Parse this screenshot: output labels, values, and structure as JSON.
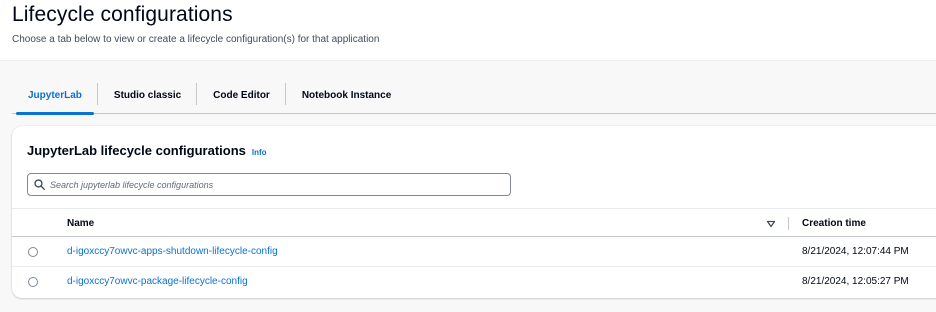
{
  "page": {
    "title": "Lifecycle configurations",
    "subtitle": "Choose a tab below to view or create a lifecycle configuration(s) for that application"
  },
  "tabs": [
    {
      "label": "JupyterLab",
      "active": true
    },
    {
      "label": "Studio classic",
      "active": false
    },
    {
      "label": "Code Editor",
      "active": false
    },
    {
      "label": "Notebook Instance",
      "active": false
    }
  ],
  "panel": {
    "title": "JupyterLab lifecycle configurations",
    "info_label": "Info",
    "search_placeholder": "Search jupyterlab lifecycle configurations"
  },
  "table": {
    "columns": {
      "name": "Name",
      "creation_time": "Creation time"
    },
    "rows": [
      {
        "name": "d-igoxccy7owvc-apps-shutdown-lifecycle-config",
        "creation_time": "8/21/2024, 12:07:44 PM",
        "selected": false
      },
      {
        "name": "d-igoxccy7owvc-package-lifecycle-config",
        "creation_time": "8/21/2024, 12:05:27 PM",
        "selected": false
      }
    ]
  },
  "icons": {
    "search": "search-icon",
    "sort": "sort-caret-down-icon"
  },
  "colors": {
    "accent": "#0972d3",
    "text": "#000716",
    "secondary_text": "#414d5c",
    "border": "#c6c6cd",
    "background": "#f8f8f8"
  }
}
